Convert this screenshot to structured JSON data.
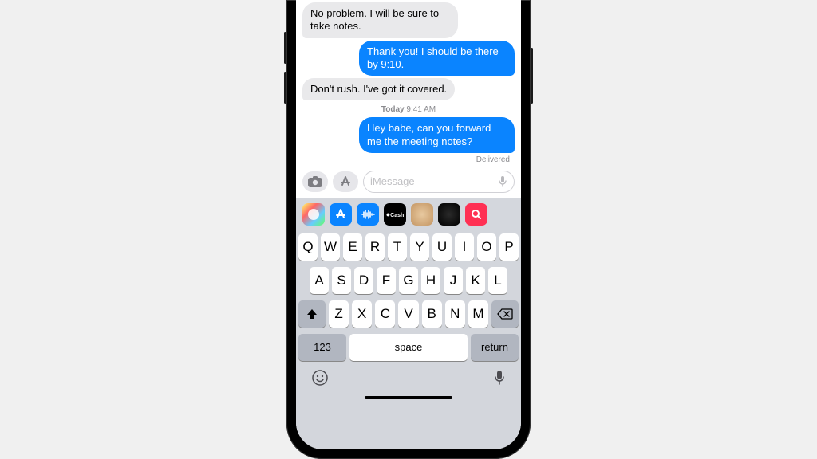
{
  "messages": [
    {
      "side": "left",
      "text": "No problem. I will be sure to take notes."
    },
    {
      "side": "right",
      "text": "Thank you! I should be there by 9:10."
    },
    {
      "side": "left",
      "text": "Don't rush. I've got it covered."
    }
  ],
  "timestamp_day": "Today",
  "timestamp_time": "9:41 AM",
  "recent_message": "Hey babe, can you forward me the meeting notes?",
  "delivered_label": "Delivered",
  "input_placeholder": "iMessage",
  "app_cash_label": "Cash",
  "keyboard": {
    "row1": [
      "Q",
      "W",
      "E",
      "R",
      "T",
      "Y",
      "U",
      "I",
      "O",
      "P"
    ],
    "row2": [
      "A",
      "S",
      "D",
      "F",
      "G",
      "H",
      "J",
      "K",
      "L"
    ],
    "row3": [
      "Z",
      "X",
      "C",
      "V",
      "B",
      "N",
      "M"
    ],
    "numkey": "123",
    "space": "space",
    "return": "return"
  }
}
